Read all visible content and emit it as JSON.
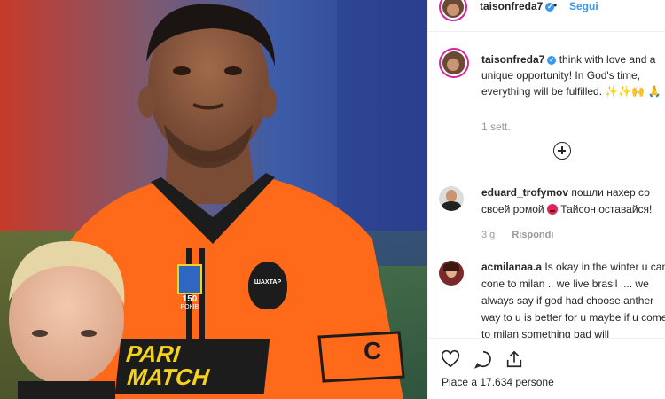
{
  "post": {
    "username": "taisonfreda7",
    "dot": "•",
    "follow_label": "Segui"
  },
  "caption": {
    "username": "taisonfreda7",
    "text": "think with love and a unique opportunity! In God's time, everything will be fulfilled.",
    "emojis": "✨✨🙌 🙏",
    "time": "1 sett."
  },
  "photo": {
    "sponsor_line1": "PARI",
    "sponsor_line2": "MATCH",
    "club_badge": "ШАХТАР",
    "badge_number": "150",
    "badge_text": "РОКІВ",
    "captain_band": "C"
  },
  "comments": [
    {
      "username": "eduard_trofymov",
      "text": "пошли нахер со своей ромой",
      "text2": "Тайсон оставайся!",
      "time": "3 g",
      "reply_label": "Rispondi"
    },
    {
      "username": "acmilanaa.a",
      "text": "Is okay in the winter u can cone to milan .. we live brasil .... we always say if god had choose anther way to u is better for u maybe if u come to milan something bad will"
    }
  ],
  "actions": {
    "likes_text": "Piace a 17.634 persone"
  },
  "colors": {
    "accent": "#3897f0",
    "kit_orange": "#ff6a1a",
    "story_ring": "#d6249f"
  }
}
